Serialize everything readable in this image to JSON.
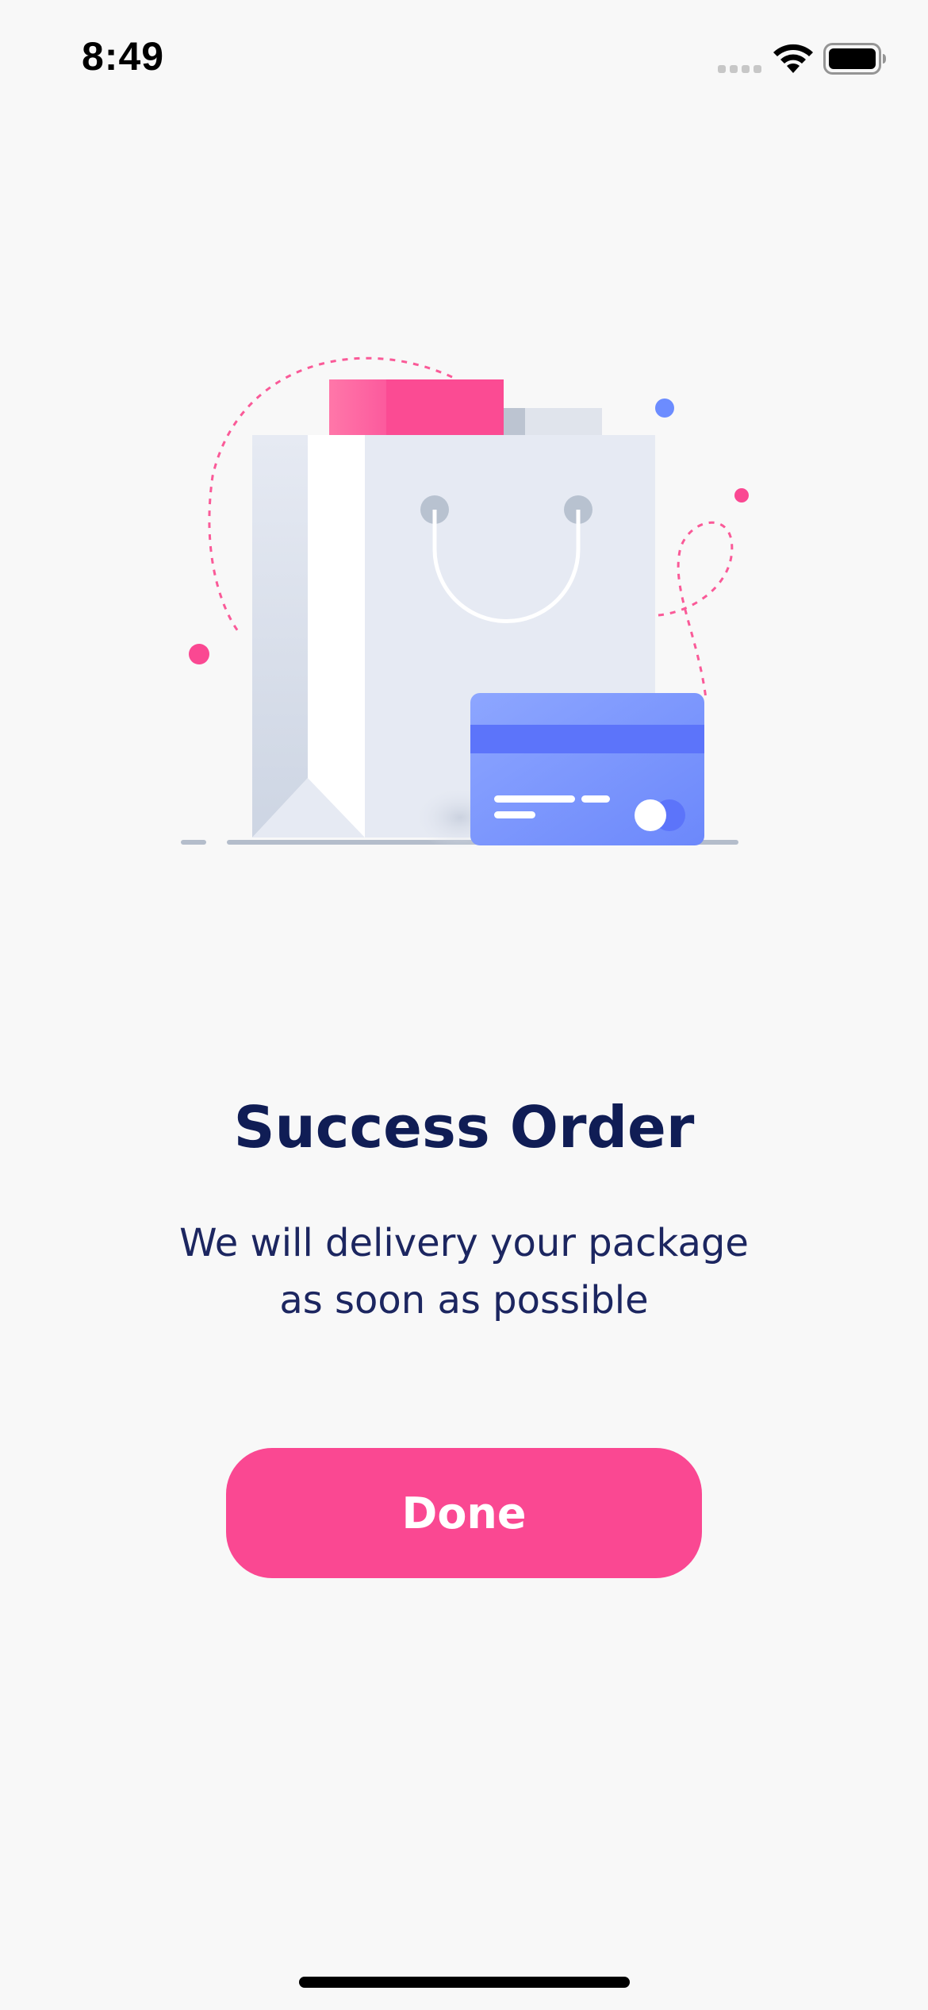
{
  "status_bar": {
    "time": "8:49",
    "icons": [
      "signal-icon",
      "wifi-icon",
      "battery-icon"
    ]
  },
  "illustration": {
    "icon": "shopping-bag-with-credit-card-illustration"
  },
  "content": {
    "title": "Success Order",
    "subtitle_line1": "We will delivery your package",
    "subtitle_line2": "as soon as possible"
  },
  "actions": {
    "done_label": "Done"
  },
  "colors": {
    "background": "#F8F8F8",
    "primary": "#FA4892",
    "title": "#101D55",
    "card": "#6C8CFF"
  }
}
